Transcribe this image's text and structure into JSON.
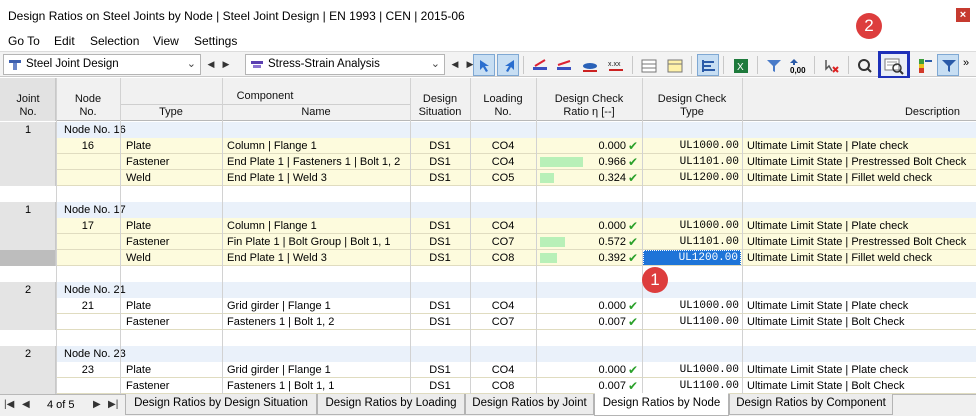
{
  "window": {
    "title": "Design Ratios on Steel Joints by Node | Steel Joint Design | EN 1993 | CEN | 2015-06",
    "close": "×"
  },
  "menu": [
    "Go To",
    "Edit",
    "Selection",
    "View",
    "Settings"
  ],
  "toolbar": {
    "module": "Steel Joint Design",
    "analysis": "Stress-Strain Analysis",
    "decimals_label": "0,00",
    "overflow": "»"
  },
  "columns": {
    "joint": [
      "Joint",
      "No."
    ],
    "node": [
      "Node",
      "No."
    ],
    "component": "Component",
    "type": "Type",
    "name": "Name",
    "situation": [
      "Design",
      "Situation"
    ],
    "loading": [
      "Loading",
      "No."
    ],
    "ratio": [
      "Design Check",
      "Ratio η [--]"
    ],
    "checktype": [
      "Design Check",
      "Type"
    ],
    "description": "Description"
  },
  "groups": [
    {
      "joint": "1",
      "label": "Node No. 16",
      "rows": [
        {
          "node": "16",
          "type": "Plate",
          "name": "Column | Flange 1",
          "situation": "DS1",
          "loading": "CO4",
          "ratio": "0.000",
          "ratio_value": 0.0,
          "checktype": "UL1000.00",
          "description": "Ultimate Limit State | Plate check"
        },
        {
          "node": "",
          "type": "Fastener",
          "name": "End Plate 1 | Fasteners 1 | Bolt 1, 2",
          "situation": "DS1",
          "loading": "CO4",
          "ratio": "0.966",
          "ratio_value": 0.966,
          "checktype": "UL1101.00",
          "description": "Ultimate Limit State | Prestressed Bolt Check"
        },
        {
          "node": "",
          "type": "Weld",
          "name": "End Plate 1 | Weld 3",
          "situation": "DS1",
          "loading": "CO5",
          "ratio": "0.324",
          "ratio_value": 0.324,
          "checktype": "UL1200.00",
          "description": "Ultimate Limit State | Fillet weld check"
        }
      ]
    },
    {
      "joint": "1",
      "label": "Node No. 17",
      "rows": [
        {
          "node": "17",
          "type": "Plate",
          "name": "Column | Flange 1",
          "situation": "DS1",
          "loading": "CO4",
          "ratio": "0.000",
          "ratio_value": 0.0,
          "checktype": "UL1000.00",
          "description": "Ultimate Limit State | Plate check"
        },
        {
          "node": "",
          "type": "Fastener",
          "name": "Fin Plate 1 | Bolt Group | Bolt 1, 1",
          "situation": "DS1",
          "loading": "CO7",
          "ratio": "0.572",
          "ratio_value": 0.572,
          "checktype": "UL1101.00",
          "description": "Ultimate Limit State | Prestressed Bolt Check"
        },
        {
          "node": "",
          "type": "Weld",
          "name": "End Plate 1 | Weld 3",
          "situation": "DS1",
          "loading": "CO8",
          "ratio": "0.392",
          "ratio_value": 0.392,
          "checktype": "UL1200.00",
          "description": "Ultimate Limit State | Fillet weld check"
        }
      ]
    },
    {
      "joint": "2",
      "label": "Node No. 21",
      "rows": [
        {
          "node": "21",
          "type": "Plate",
          "name": "Grid girder | Flange 1",
          "situation": "DS1",
          "loading": "CO4",
          "ratio": "0.000",
          "ratio_value": 0.0,
          "checktype": "UL1000.00",
          "description": "Ultimate Limit State | Plate check"
        },
        {
          "node": "",
          "type": "Fastener",
          "name": "Fasteners 1 | Bolt 1, 2",
          "situation": "DS1",
          "loading": "CO7",
          "ratio": "0.007",
          "ratio_value": 0.007,
          "checktype": "UL1100.00",
          "description": "Ultimate Limit State | Bolt Check"
        }
      ]
    },
    {
      "joint": "2",
      "label": "Node No. 23",
      "rows": [
        {
          "node": "23",
          "type": "Plate",
          "name": "Grid girder | Flange 1",
          "situation": "DS1",
          "loading": "CO4",
          "ratio": "0.000",
          "ratio_value": 0.0,
          "checktype": "UL1000.00",
          "description": "Ultimate Limit State | Plate check"
        },
        {
          "node": "",
          "type": "Fastener",
          "name": "Fasteners 1 | Bolt 1, 1",
          "situation": "DS1",
          "loading": "CO8",
          "ratio": "0.007",
          "ratio_value": 0.007,
          "checktype": "UL1100.00",
          "description": "Ultimate Limit State | Bolt Check"
        }
      ]
    }
  ],
  "badges": {
    "one": "1",
    "two": "2"
  },
  "pager": {
    "text": "4 of 5",
    "first": "|◀",
    "prev": "◀",
    "next": "▶",
    "last": "▶|"
  },
  "tabs": [
    "Design Ratios by Design Situation",
    "Design Ratios by Loading",
    "Design Ratios by Joint",
    "Design Ratios by Node",
    "Design Ratios by Component"
  ],
  "active_tab": 3,
  "colors": {
    "highlight_border": "#1d30b9",
    "badge": "#dd3d3d",
    "ratio_bar": "#b8f0b8",
    "selection": "#1e74d8"
  }
}
